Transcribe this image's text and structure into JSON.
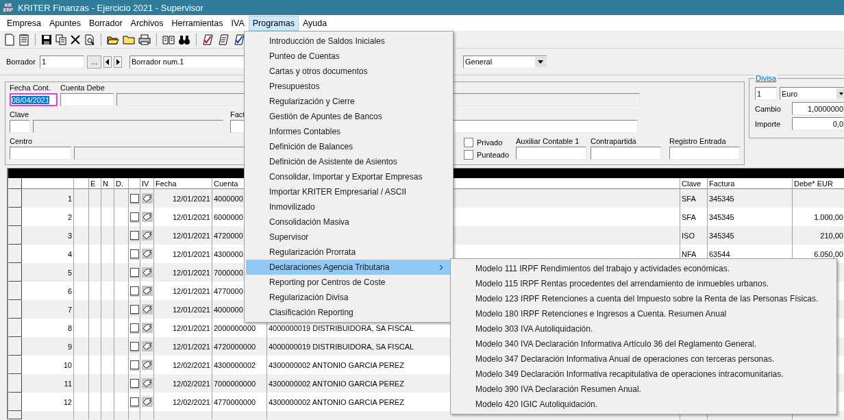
{
  "window": {
    "logo": [
      "KR",
      "ERP"
    ],
    "title": "KRITER Finanzas - Ejercicio 2021 - Supervisor"
  },
  "menu_bar": [
    {
      "label": "Empresa",
      "selected": false
    },
    {
      "label": "Apuntes",
      "selected": false
    },
    {
      "label": "Borrador",
      "selected": false
    },
    {
      "label": "Archivos",
      "selected": false
    },
    {
      "label": "Herramientas",
      "selected": false
    },
    {
      "label": "IVA",
      "selected": false
    },
    {
      "label": "Programas",
      "selected": true
    },
    {
      "label": "Ayuda",
      "selected": false
    }
  ],
  "borrador": {
    "label": "Borrador",
    "number": "1",
    "browse_button": "...",
    "description": "Borrador num.1",
    "type": "General"
  },
  "form": {
    "fecha_label": "Fecha Cont.",
    "fecha": "08/04/2021",
    "cuenta_debe_label": "Cuenta Debe",
    "clave_label": "Clave",
    "factura_label": "Fact",
    "centro_label": "Centro",
    "checkboxes": [
      {
        "label": "Privado",
        "checked": false
      },
      {
        "label": "Punteado",
        "checked": false
      }
    ],
    "fields": [
      {
        "label": "Auxiliar Contable 1"
      },
      {
        "label": "Contrapartida"
      },
      {
        "label": "Registro  Entrada"
      }
    ]
  },
  "divisa": {
    "title": "Divisa",
    "code": "1",
    "currency": "Euro",
    "cambio_label": "Cambio",
    "cambio": "1,0000000",
    "importe_label": "Importe",
    "importe": "0,0"
  },
  "grid": {
    "header": {
      "e": "E",
      "n": "N",
      "d": "D.",
      "iv": "IV",
      "fecha": "Fecha",
      "cuenta": "Cuenta",
      "clave": "Clave",
      "factura": "Factura",
      "debe": "Debe* EUR"
    },
    "rows": [
      {
        "number": "1",
        "checked": false,
        "fecha": "12/01/2021",
        "cuenta": "4000000",
        "clave": "SFA",
        "factura": "345345"
      },
      {
        "number": "2",
        "checked": false,
        "fecha": "12/01/2021",
        "cuenta": "6000000",
        "clave": "SFA",
        "factura": "345345",
        "debe": "1.000,00"
      },
      {
        "number": "3",
        "checked": false,
        "fecha": "12/01/2021",
        "cuenta": "4720000",
        "clave": "ISO",
        "factura": "345345",
        "debe": "210,00"
      },
      {
        "number": "4",
        "checked": false,
        "fecha": "12/01/2021",
        "cuenta": "4300000",
        "clave": "NFA",
        "factura": "63544",
        "debe": "6.050,00"
      },
      {
        "number": "5",
        "checked": false,
        "fecha": "12/01/2021",
        "cuenta": "7000000"
      },
      {
        "number": "6",
        "checked": false,
        "fecha": "12/01/2021",
        "cuenta": "4770000"
      },
      {
        "number": "7",
        "checked": false,
        "fecha": "12/01/2021",
        "cuenta": "4000000"
      },
      {
        "number": "8",
        "checked": false,
        "fecha": "12/01/2021",
        "cuenta": "2000000000",
        "descripcion": "4000000019 DISTRIBUIDORA, SA FISCAL"
      },
      {
        "number": "9",
        "checked": false,
        "fecha": "12/01/2021",
        "cuenta": "4720000000",
        "descripcion": "4000000019 DISTRIBUIDORA, SA FISCAL"
      },
      {
        "number": "10",
        "checked": false,
        "fecha": "12/02/2021",
        "cuenta": "4300000002",
        "descripcion": "4300000002 ANTONIO GARCIA PEREZ"
      },
      {
        "number": "11",
        "checked": false,
        "fecha": "12/02/2021",
        "cuenta": "7000000000",
        "descripcion": "4300000002 ANTONIO GARCIA PEREZ"
      },
      {
        "number": "12",
        "checked": false,
        "fecha": "12/02/2021",
        "cuenta": "4770000000",
        "descripcion": "4300000002 ANTONIO GARCIA PEREZ"
      }
    ]
  },
  "programas_menu": {
    "items": [
      {
        "label": "Introducción de Saldos Iniciales",
        "selected": false,
        "has_submenu": false
      },
      {
        "label": "Punteo de Cuentas",
        "selected": false,
        "has_submenu": false
      },
      {
        "label": "Cartas y otros documentos",
        "selected": false,
        "has_submenu": false
      },
      {
        "label": "Presupuestos",
        "selected": false,
        "has_submenu": false
      },
      {
        "label": "Regularización y Cierre",
        "selected": false,
        "has_submenu": false
      },
      {
        "label": "Gestión de Apuntes de Bancos",
        "selected": false,
        "has_submenu": false
      },
      {
        "label": "Informes Contables",
        "selected": false,
        "has_submenu": false
      },
      {
        "label": "Definición de Balances",
        "selected": false,
        "has_submenu": false
      },
      {
        "label": "Definición de Asistente de Asientos",
        "selected": false,
        "has_submenu": false
      },
      {
        "label": "Consolidar, Importar y Exportar Empresas",
        "selected": false,
        "has_submenu": false
      },
      {
        "label": "Importar KRITER Empresarial / ASCII",
        "selected": false,
        "has_submenu": false
      },
      {
        "label": "Inmovilizado",
        "selected": false,
        "has_submenu": false
      },
      {
        "label": "Consolidación Masiva",
        "selected": false,
        "has_submenu": false
      },
      {
        "label": "Supervisor",
        "selected": false,
        "has_submenu": false
      },
      {
        "label": "Regularización Prorrata",
        "selected": false,
        "has_submenu": false
      },
      {
        "label": "Declaraciones Agencia Tributaria",
        "selected": true,
        "has_submenu": true
      },
      {
        "label": "Reporting por Centros de Coste",
        "selected": false,
        "has_submenu": false
      },
      {
        "label": "Regularización Divisa",
        "selected": false,
        "has_submenu": false
      },
      {
        "label": "Clasificación Reporting",
        "selected": false,
        "has_submenu": false
      }
    ]
  },
  "submenu": {
    "items": [
      "Modelo 111 IRPF Rendimientos del trabajo y actividades económicas.",
      "Modelo 115 IRPF Rentas procedentes del arrendamiento de inmuebles urbanos.",
      "Modelo 123 IRPF Retenciones a cuenta del Impuesto sobre la Renta de las Personas Físicas.",
      "Modelo 180 IRPF Retenciones e Ingresos a Cuenta. Resumen Anual",
      "Modelo 303 IVA Autoliquidación.",
      "Modelo 340 IVA Declaración Informativa Artículo 36 del Reglamento General.",
      "Modelo 347 Declaración Informativa Anual de operaciones con terceras personas.",
      "Modelo 349 Declaración Informativa recapitulativa de operaciones intracomunitarias.",
      "Modelo 390 IVA Declaración Resumen Anual.",
      "Modelo 420 IGIC Autoliquidación."
    ]
  }
}
